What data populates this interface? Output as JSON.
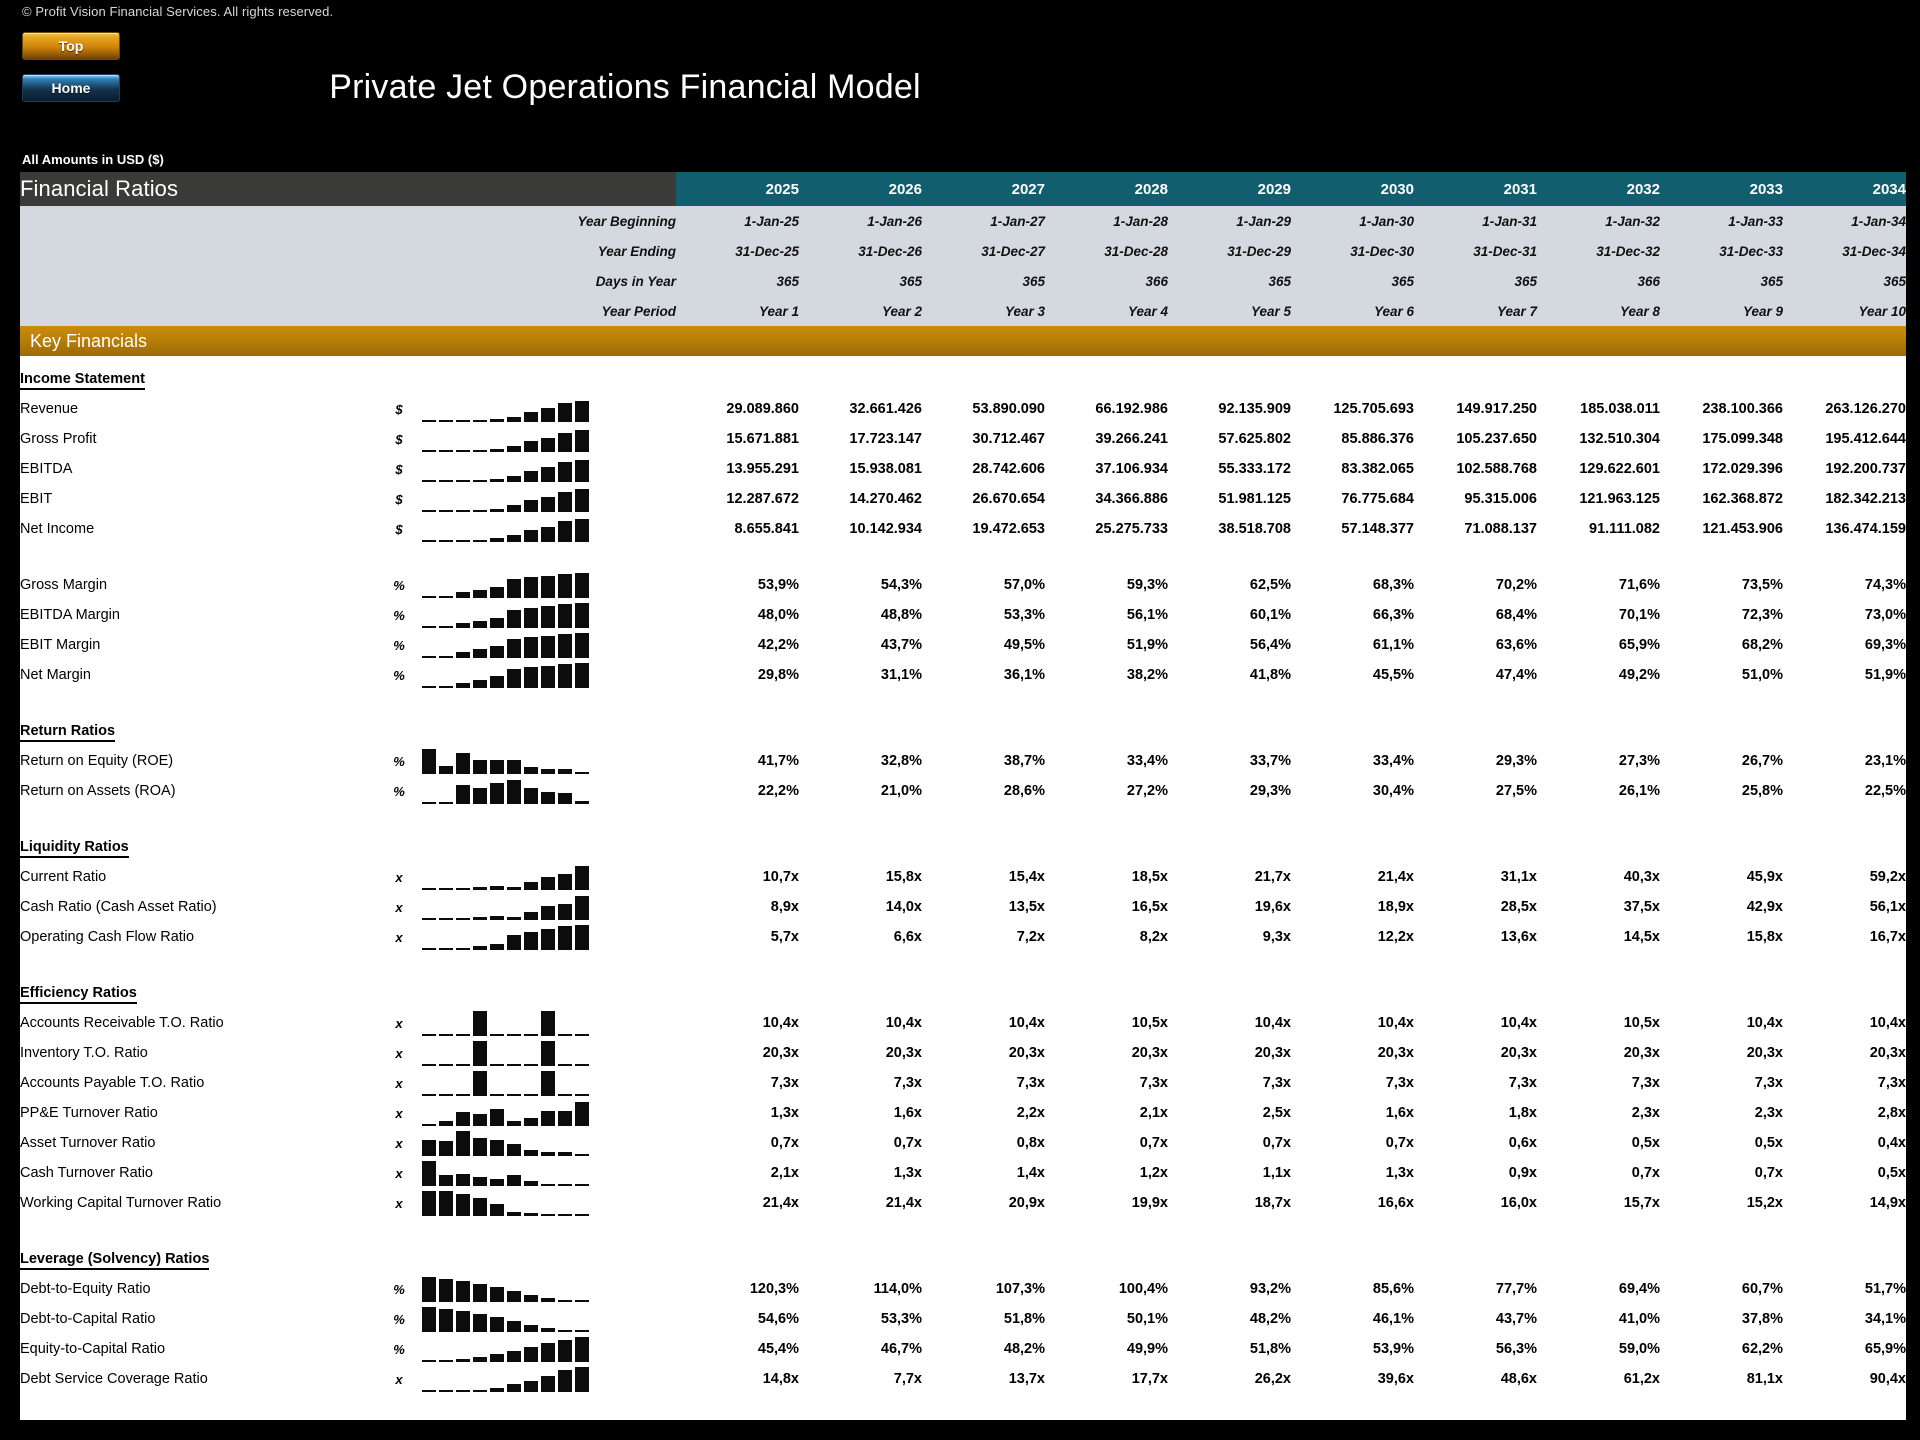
{
  "header": {
    "copyright": "© Profit Vision Financial Services. All rights reserved.",
    "title": "Private Jet Operations Financial Model",
    "units_label": "All Amounts in  USD ($)",
    "buttons": [
      {
        "label": "Top",
        "name": "top-button"
      },
      {
        "label": "Home",
        "name": "home-button"
      }
    ]
  },
  "sheet": {
    "title": "Financial Ratios",
    "section_title": "Key Financials",
    "accent_teal": "#115e6e",
    "accent_gold": "#b97f08",
    "header_gray": "#3a3a38",
    "date_band_bg": "#d3d9de"
  },
  "columns": {
    "years": [
      "2025",
      "2026",
      "2027",
      "2028",
      "2029",
      "2030",
      "2031",
      "2032",
      "2033",
      "2034"
    ],
    "meta_rows": [
      {
        "label": "Year Beginning",
        "values": [
          "1-Jan-25",
          "1-Jan-26",
          "1-Jan-27",
          "1-Jan-28",
          "1-Jan-29",
          "1-Jan-30",
          "1-Jan-31",
          "1-Jan-32",
          "1-Jan-33",
          "1-Jan-34"
        ]
      },
      {
        "label": "Year Ending",
        "values": [
          "31-Dec-25",
          "31-Dec-26",
          "31-Dec-27",
          "31-Dec-28",
          "31-Dec-29",
          "31-Dec-30",
          "31-Dec-31",
          "31-Dec-32",
          "31-Dec-33",
          "31-Dec-34"
        ]
      },
      {
        "label": "Days in Year",
        "values": [
          "365",
          "365",
          "365",
          "366",
          "365",
          "365",
          "365",
          "366",
          "365",
          "365"
        ]
      },
      {
        "label": "Year Period",
        "values": [
          "Year 1",
          "Year 2",
          "Year 3",
          "Year 4",
          "Year 5",
          "Year 6",
          "Year 7",
          "Year 8",
          "Year 9",
          "Year 10"
        ]
      }
    ]
  },
  "groups": [
    {
      "title": "Income Statement",
      "rows": [
        {
          "label": "Revenue",
          "unit": "$",
          "values": [
            "29.089.860",
            "32.661.426",
            "53.890.090",
            "66.192.986",
            "92.135.909",
            "125.705.693",
            "149.917.250",
            "185.038.011",
            "238.100.366",
            "263.126.270"
          ],
          "spark": [
            2,
            3,
            5,
            7,
            11,
            18,
            40,
            52,
            72,
            82
          ]
        },
        {
          "label": "Gross Profit",
          "unit": "$",
          "values": [
            "15.671.881",
            "17.723.147",
            "30.712.467",
            "39.266.241",
            "57.625.802",
            "85.886.376",
            "105.237.650",
            "132.510.304",
            "175.099.348",
            "195.412.644"
          ],
          "spark": [
            2,
            3,
            5,
            7,
            12,
            22,
            42,
            54,
            74,
            84
          ]
        },
        {
          "label": "EBITDA",
          "unit": "$",
          "values": [
            "13.955.291",
            "15.938.081",
            "28.742.606",
            "37.106.934",
            "55.333.172",
            "83.382.065",
            "102.588.768",
            "129.622.601",
            "172.029.396",
            "192.200.737"
          ],
          "spark": [
            2,
            3,
            5,
            7,
            13,
            24,
            44,
            56,
            76,
            86
          ]
        },
        {
          "label": "EBIT",
          "unit": "$",
          "values": [
            "12.287.672",
            "14.270.462",
            "26.670.654",
            "34.366.886",
            "51.981.125",
            "76.775.684",
            "95.315.006",
            "121.963.125",
            "162.368.872",
            "182.342.213"
          ],
          "spark": [
            2,
            3,
            5,
            7,
            13,
            25,
            45,
            58,
            78,
            88
          ]
        },
        {
          "label": "Net Income",
          "unit": "$",
          "values": [
            "8.655.841",
            "10.142.934",
            "19.472.653",
            "25.275.733",
            "38.518.708",
            "57.148.377",
            "71.088.137",
            "91.111.082",
            "121.453.906",
            "136.474.159"
          ],
          "spark": [
            2,
            3,
            5,
            7,
            14,
            26,
            46,
            59,
            80,
            90
          ]
        }
      ]
    },
    {
      "title": "",
      "rows": [
        {
          "label": "Gross Margin",
          "unit": "%",
          "values": [
            "53,9%",
            "54,3%",
            "57,0%",
            "59,3%",
            "62,5%",
            "68,3%",
            "70,2%",
            "71,6%",
            "73,5%",
            "74,3%"
          ],
          "spark": [
            2,
            3,
            22,
            32,
            44,
            72,
            80,
            85,
            92,
            96
          ]
        },
        {
          "label": "EBITDA Margin",
          "unit": "%",
          "values": [
            "48,0%",
            "48,8%",
            "53,3%",
            "56,1%",
            "60,1%",
            "66,3%",
            "68,4%",
            "70,1%",
            "72,3%",
            "73,0%"
          ],
          "spark": [
            2,
            3,
            18,
            28,
            40,
            70,
            78,
            84,
            92,
            95
          ]
        },
        {
          "label": "EBIT Margin",
          "unit": "%",
          "values": [
            "42,2%",
            "43,7%",
            "49,5%",
            "51,9%",
            "56,4%",
            "61,1%",
            "63,6%",
            "65,9%",
            "68,2%",
            "69,3%"
          ],
          "spark": [
            2,
            4,
            24,
            34,
            48,
            72,
            80,
            86,
            93,
            97
          ]
        },
        {
          "label": "Net Margin",
          "unit": "%",
          "values": [
            "29,8%",
            "31,1%",
            "36,1%",
            "38,2%",
            "41,8%",
            "45,5%",
            "47,4%",
            "49,2%",
            "51,0%",
            "51,9%"
          ],
          "spark": [
            2,
            3,
            20,
            32,
            46,
            72,
            80,
            86,
            93,
            97
          ]
        }
      ]
    },
    {
      "title": "Return Ratios",
      "rows": [
        {
          "label": "Return on Equity (ROE)",
          "unit": "%",
          "values": [
            "41,7%",
            "32,8%",
            "38,7%",
            "33,4%",
            "33,7%",
            "33,4%",
            "29,3%",
            "27,3%",
            "26,7%",
            "23,1%"
          ],
          "spark": [
            96,
            30,
            82,
            52,
            54,
            52,
            28,
            20,
            18,
            4
          ]
        },
        {
          "label": "Return on Assets (ROA)",
          "unit": "%",
          "values": [
            "22,2%",
            "21,0%",
            "28,6%",
            "27,2%",
            "29,3%",
            "30,4%",
            "27,5%",
            "26,1%",
            "25,8%",
            "22,5%"
          ],
          "spark": [
            6,
            3,
            72,
            60,
            82,
            92,
            62,
            46,
            42,
            10
          ]
        }
      ]
    },
    {
      "title": "Liquidity Ratios",
      "rows": [
        {
          "label": "Current Ratio",
          "unit": "x",
          "values": [
            "10,7x",
            "15,8x",
            "15,4x",
            "18,5x",
            "21,7x",
            "21,4x",
            "31,1x",
            "40,3x",
            "45,9x",
            "59,2x"
          ],
          "spark": [
            2,
            6,
            6,
            10,
            14,
            13,
            32,
            50,
            60,
            92
          ]
        },
        {
          "label": "Cash Ratio (Cash Asset Ratio)",
          "unit": "x",
          "values": [
            "8,9x",
            "14,0x",
            "13,5x",
            "16,5x",
            "19,6x",
            "18,9x",
            "28,5x",
            "37,5x",
            "42,9x",
            "56,1x"
          ],
          "spark": [
            2,
            6,
            6,
            10,
            14,
            13,
            32,
            52,
            62,
            94
          ]
        },
        {
          "label": "Operating Cash Flow Ratio",
          "unit": "x",
          "values": [
            "5,7x",
            "6,6x",
            "7,2x",
            "8,2x",
            "9,3x",
            "12,2x",
            "13,6x",
            "14,5x",
            "15,8x",
            "16,7x"
          ],
          "spark": [
            2,
            4,
            8,
            14,
            22,
            56,
            70,
            80,
            92,
            98
          ]
        }
      ]
    },
    {
      "title": "Efficiency Ratios",
      "rows": [
        {
          "label": "Accounts Receivable T.O. Ratio",
          "unit": "x",
          "values": [
            "10,4x",
            "10,4x",
            "10,4x",
            "10,5x",
            "10,4x",
            "10,4x",
            "10,4x",
            "10,5x",
            "10,4x",
            "10,4x"
          ],
          "spark": [
            2,
            2,
            2,
            96,
            2,
            2,
            2,
            96,
            2,
            2
          ]
        },
        {
          "label": "Inventory T.O. Ratio",
          "unit": "x",
          "values": [
            "20,3x",
            "20,3x",
            "20,3x",
            "20,3x",
            "20,3x",
            "20,3x",
            "20,3x",
            "20,3x",
            "20,3x",
            "20,3x"
          ],
          "spark": [
            2,
            2,
            2,
            96,
            2,
            2,
            2,
            96,
            2,
            2
          ]
        },
        {
          "label": "Accounts Payable T.O. Ratio",
          "unit": "x",
          "values": [
            "7,3x",
            "7,3x",
            "7,3x",
            "7,3x",
            "7,3x",
            "7,3x",
            "7,3x",
            "7,3x",
            "7,3x",
            "7,3x"
          ],
          "spark": [
            2,
            2,
            2,
            96,
            2,
            2,
            2,
            96,
            2,
            2
          ]
        },
        {
          "label": "PP&E Turnover Ratio",
          "unit": "x",
          "values": [
            "1,3x",
            "1,6x",
            "2,2x",
            "2,1x",
            "2,5x",
            "1,6x",
            "1,8x",
            "2,3x",
            "2,3x",
            "2,8x"
          ],
          "spark": [
            4,
            20,
            52,
            46,
            66,
            20,
            30,
            56,
            56,
            92
          ]
        },
        {
          "label": "Asset Turnover Ratio",
          "unit": "x",
          "values": [
            "0,7x",
            "0,7x",
            "0,8x",
            "0,7x",
            "0,7x",
            "0,7x",
            "0,6x",
            "0,5x",
            "0,5x",
            "0,4x"
          ],
          "spark": [
            62,
            58,
            96,
            68,
            62,
            48,
            22,
            16,
            14,
            3
          ]
        },
        {
          "label": "Cash Turnover Ratio",
          "unit": "x",
          "values": [
            "2,1x",
            "1,3x",
            "1,4x",
            "1,2x",
            "1,1x",
            "1,3x",
            "0,9x",
            "0,7x",
            "0,7x",
            "0,5x"
          ],
          "spark": [
            96,
            42,
            48,
            36,
            28,
            42,
            18,
            8,
            8,
            3
          ]
        },
        {
          "label": "Working Capital Turnover Ratio",
          "unit": "x",
          "values": [
            "21,4x",
            "21,4x",
            "20,9x",
            "19,9x",
            "18,7x",
            "16,6x",
            "16,0x",
            "15,7x",
            "15,2x",
            "14,9x"
          ],
          "spark": [
            96,
            96,
            86,
            70,
            48,
            16,
            10,
            7,
            4,
            3
          ]
        }
      ]
    },
    {
      "title": "Leverage (Solvency) Ratios",
      "rows": [
        {
          "label": "Debt-to-Equity Ratio",
          "unit": "%",
          "values": [
            "120,3%",
            "114,0%",
            "107,3%",
            "100,4%",
            "93,2%",
            "85,6%",
            "77,7%",
            "69,4%",
            "60,7%",
            "51,7%"
          ],
          "spark": [
            96,
            88,
            80,
            70,
            58,
            44,
            28,
            16,
            8,
            3
          ]
        },
        {
          "label": "Debt-to-Capital Ratio",
          "unit": "%",
          "values": [
            "54,6%",
            "53,3%",
            "51,8%",
            "50,1%",
            "48,2%",
            "46,1%",
            "43,7%",
            "41,0%",
            "37,8%",
            "34,1%"
          ],
          "spark": [
            96,
            88,
            80,
            70,
            58,
            44,
            28,
            16,
            8,
            3
          ]
        },
        {
          "label": "Equity-to-Capital Ratio",
          "unit": "%",
          "values": [
            "45,4%",
            "46,7%",
            "48,2%",
            "49,9%",
            "51,8%",
            "53,9%",
            "56,3%",
            "59,0%",
            "62,2%",
            "65,9%"
          ],
          "spark": [
            2,
            6,
            12,
            20,
            30,
            44,
            58,
            72,
            86,
            96
          ]
        },
        {
          "label": "Debt Service Coverage Ratio",
          "unit": "x",
          "values": [
            "14,8x",
            "7,7x",
            "13,7x",
            "17,7x",
            "26,2x",
            "39,6x",
            "48,6x",
            "61,2x",
            "81,1x",
            "90,4x"
          ],
          "spark": [
            3,
            2,
            4,
            6,
            14,
            30,
            42,
            60,
            86,
            96
          ]
        }
      ]
    }
  ]
}
